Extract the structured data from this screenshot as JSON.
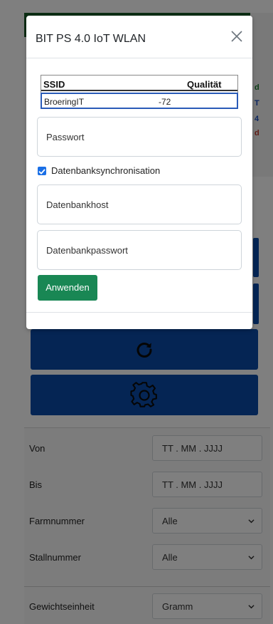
{
  "modal": {
    "title": "BIT PS 4.0 IoT WLAN",
    "wifi_table": {
      "headers": {
        "ssid": "SSID",
        "quality": "Qualität"
      },
      "rows": [
        {
          "ssid": "BroeringIT",
          "quality": "-72"
        }
      ]
    },
    "password_placeholder": "Passwort",
    "db_sync": {
      "label": "Datenbanksynchronisation",
      "checked": true
    },
    "db_host_placeholder": "Datenbankhost",
    "db_password_placeholder": "Datenbankpasswort",
    "apply_label": "Anwenden"
  },
  "background": {
    "side_letters": [
      "d",
      "T",
      "4",
      "d"
    ],
    "buttons": [
      {
        "icon": "refresh-icon"
      },
      {
        "icon": "gear-icon"
      }
    ],
    "filters": [
      {
        "label": "Von",
        "value": "TT . MM . JJJJ",
        "type": "date"
      },
      {
        "label": "Bis",
        "value": "TT . MM . JJJJ",
        "type": "date"
      },
      {
        "label": "Farmnummer",
        "value": "Alle",
        "type": "select"
      },
      {
        "label": "Stallnummer",
        "value": "Alle",
        "type": "select"
      },
      {
        "label": "Gewichtseinheit",
        "value": "Gramm",
        "type": "select"
      }
    ]
  },
  "colors": {
    "header_green": "#1a5c2a",
    "button_blue": "#0a4ba8",
    "apply_green": "#198754",
    "checkbox_blue": "#1a6fe6",
    "side_letter_green": "#1a7a2e",
    "side_letter_blue": "#1a4fc0",
    "side_letter_red": "#c0392b"
  }
}
